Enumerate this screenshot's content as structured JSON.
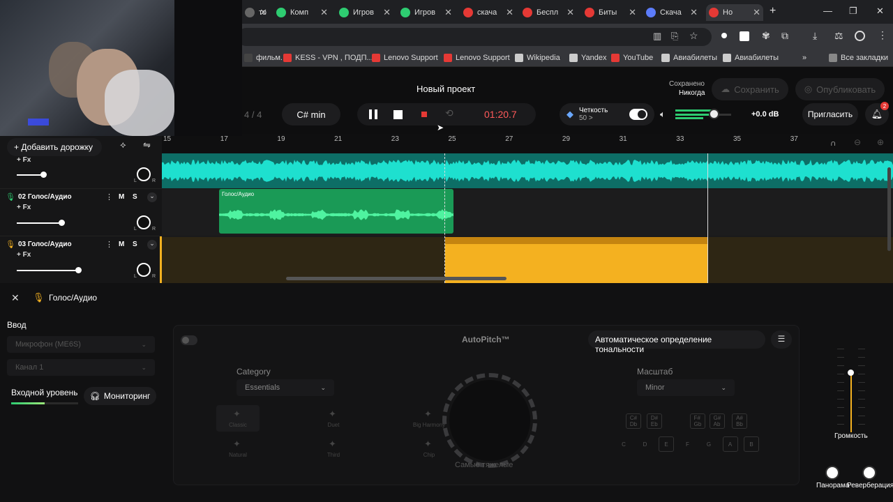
{
  "browser": {
    "tabs": [
      {
        "label": "то",
        "fav": "#666"
      },
      {
        "label": "Комп",
        "fav": "#2ecc71"
      },
      {
        "label": "Игров",
        "fav": "#2ecc71"
      },
      {
        "label": "Игров",
        "fav": "#2ecc71"
      },
      {
        "label": "скача",
        "fav": "#e53935"
      },
      {
        "label": "Беспл",
        "fav": "#e53935"
      },
      {
        "label": "Биты",
        "fav": "#e53935"
      },
      {
        "label": "Скача",
        "fav": "#5c7cfa"
      },
      {
        "label": "Но",
        "fav": "#e53935"
      }
    ],
    "bookmarks": [
      {
        "label": "фильм...",
        "icon": "#444"
      },
      {
        "label": "KESS - VPN , ПОДП...",
        "icon": "#e53935"
      },
      {
        "label": "Lenovo Support",
        "icon": "#e53935"
      },
      {
        "label": "Lenovo Support",
        "icon": "#e53935"
      },
      {
        "label": "Wikipedia",
        "icon": "#ccc"
      },
      {
        "label": "Yandex",
        "icon": "#ccc"
      },
      {
        "label": "YouTube",
        "icon": "#e53935"
      },
      {
        "label": "Авиабилеты",
        "icon": "#ccc"
      },
      {
        "label": "Авиабилеты",
        "icon": "#ccc"
      },
      {
        "label": "»",
        "icon": "transparent"
      },
      {
        "label": "Все закладки",
        "icon": "#888"
      }
    ]
  },
  "header": {
    "project_title": "Новый проект",
    "saved_label": "Сохранено",
    "saved_value": "Никогда",
    "save_button": "Сохранить",
    "publish_button": "Опубликовать",
    "time_signature": "4 / 4",
    "key": "C# min",
    "time": "01:20.7",
    "clarity_label": "Четкость",
    "clarity_value": "50 >",
    "volume_db": "+0.0 dB",
    "invite_button": "Пригласить",
    "notif_count": "2",
    "add_track": "+ Добавить дорожку"
  },
  "ruler": [
    "15",
    "17",
    "19",
    "21",
    "23",
    "25",
    "27",
    "29",
    "31",
    "33",
    "35",
    "37"
  ],
  "tracks": [
    {
      "name": "",
      "fx": "+ Fx",
      "volume": 0.27
    },
    {
      "name": "02  Голос/Аудио",
      "fx": "+ Fx",
      "volume": 0.46,
      "clip_label": "Голос/Аудио"
    },
    {
      "name": "03  Голос/Аудио",
      "fx": "+ Fx",
      "volume": 0.63
    }
  ],
  "track_buttons": {
    "mute": "M",
    "solo": "S",
    "pan_l": "L",
    "pan_r": "R"
  },
  "panel": {
    "title": "Голос/Аудио",
    "input_label": "Ввод",
    "mic": "Микрофон (ME6S)",
    "channel": "Канал 1",
    "input_level": "Входной уровень",
    "monitoring": "Мониторинг",
    "autopitch": "AutoPitch™",
    "auto_key": "Автоматическое определение тональности",
    "category_label": "Category",
    "category_value": "Essentials",
    "scale_label": "Масштаб",
    "scale_value": "Minor",
    "presets": [
      "Classic",
      "Duet",
      "Big Harmony",
      "Natural",
      "Third",
      "Chip"
    ],
    "knob_label": "Самые тяжелые",
    "sharps": [
      "C#\nDb",
      "D#\nEb",
      "F#\nGb",
      "G#\nAb",
      "A#\nBb"
    ],
    "naturals": [
      "C",
      "D",
      "E",
      "F",
      "G",
      "A",
      "B"
    ],
    "volume_label": "Громкость",
    "pan_label": "Панорама",
    "reverb_label": "Реверберация"
  }
}
